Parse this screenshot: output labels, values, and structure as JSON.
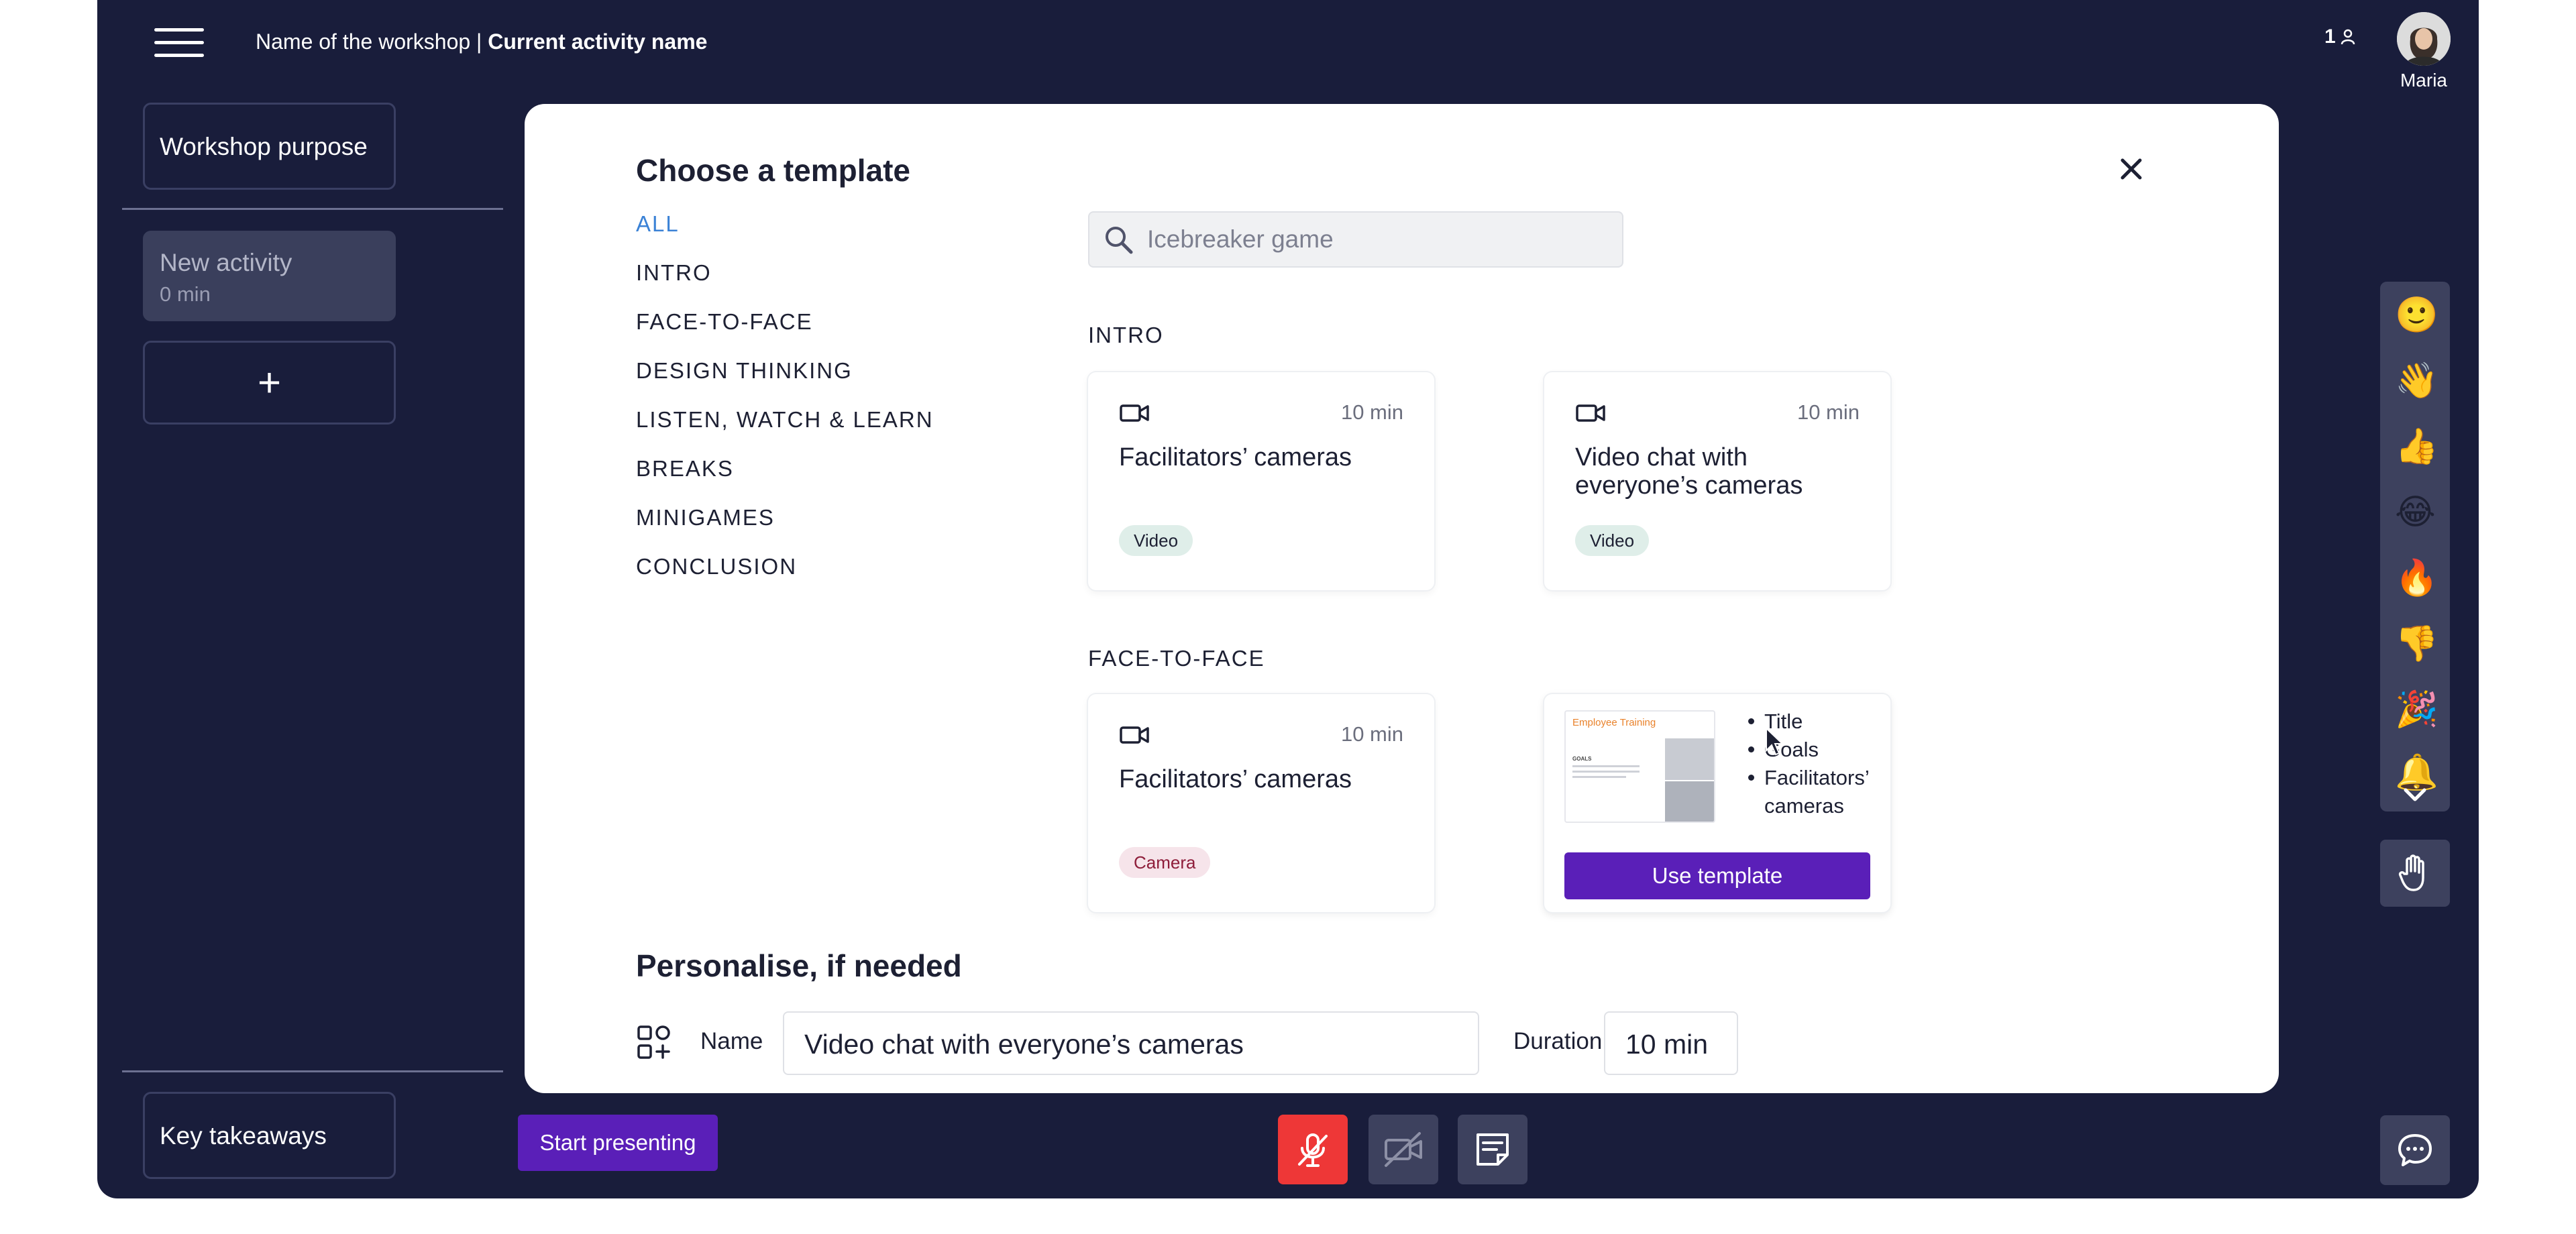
{
  "topbar": {
    "workshop_name": "Name of the workshop",
    "separator": "|",
    "activity_name": "Current activity name",
    "participants_count": "1",
    "user_name": "Maria"
  },
  "sidebar": {
    "purpose": "Workshop purpose",
    "activity_title": "New activity",
    "activity_duration": "0 min",
    "add_label": "+",
    "takeaways": "Key takeaways"
  },
  "modal": {
    "title": "Choose a template",
    "categories": [
      "ALL",
      "INTRO",
      "FACE-TO-FACE",
      "DESIGN THINKING",
      "LISTEN, WATCH & LEARN",
      "BREAKS",
      "MINIGAMES",
      "CONCLUSION"
    ],
    "search_placeholder": "Icebreaker game",
    "sections": {
      "intro": "INTRO",
      "face": "FACE-TO-FACE"
    },
    "cards": [
      {
        "duration": "10 min",
        "name": "Facilitators’ cameras",
        "tag": "Video"
      },
      {
        "duration": "10 min",
        "name": "Video chat with everyone’s cameras",
        "tag": "Video"
      },
      {
        "duration": "10 min",
        "name": "Facilitators’ cameras",
        "tag": "Camera"
      }
    ],
    "preview": {
      "thumb_title": "Employee Training",
      "thumb_goals": "GOALS",
      "bullets": [
        "Title",
        "Goals",
        "Facilitators’ cameras"
      ],
      "use_label": "Use template"
    },
    "personalise_title": "Personalise, if needed",
    "name_label": "Name",
    "name_value": "Video chat with everyone’s cameras",
    "duration_label": "Duration",
    "duration_value": "10 min"
  },
  "bottom": {
    "start_label": "Start presenting"
  },
  "reactions": [
    "🙂",
    "👋",
    "👍",
    "😂",
    "🔥",
    "👎",
    "🎉",
    "🔔"
  ],
  "colors": {
    "background": "#191d3b",
    "accent": "#5a1fb8",
    "mic_off": "#ee3737",
    "active_category": "#3b82d6"
  }
}
